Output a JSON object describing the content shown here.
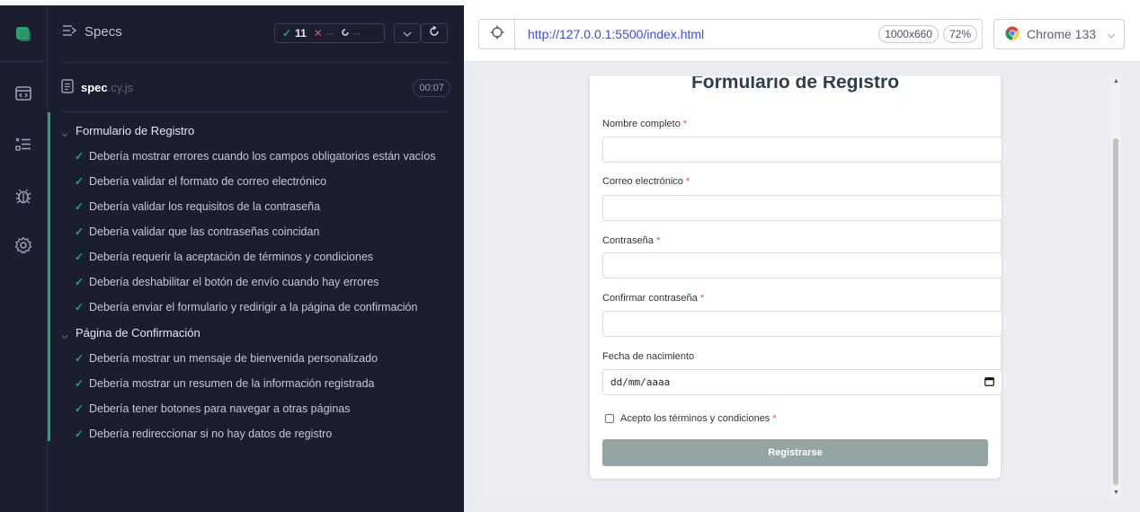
{
  "specs_panel": {
    "title": "Specs",
    "stats": {
      "passed": "11",
      "failed": "--",
      "pending": "--"
    },
    "spec_file": {
      "name": "spec",
      "ext": ".cy.js",
      "duration": "00:07"
    },
    "suites": [
      {
        "title": "Formulario de Registro",
        "tests": [
          "Debería mostrar errores cuando los campos obligatorios están vacíos",
          "Debería validar el formato de correo electrónico",
          "Debería validar los requisitos de la contraseña",
          "Debería validar que las contraseñas coincidan",
          "Debería requerir la aceptación de términos y condiciones",
          "Debería deshabilitar el botón de envío cuando hay errores",
          "Debería enviar el formulario y redirigir a la página de confirmación"
        ]
      },
      {
        "title": "Página de Confirmación",
        "tests": [
          "Debería mostrar un mensaje de bienvenida personalizado",
          "Debería mostrar un resumen de la información registrada",
          "Debería tener botones para navegar a otras páginas",
          "Debería redireccionar si no hay datos de registro"
        ]
      }
    ]
  },
  "aut_header": {
    "url": "http://127.0.0.1:5500/index.html",
    "viewport_size": "1000x660",
    "zoom": "72%",
    "browser": "Chrome 133"
  },
  "form": {
    "title": "Formulario de Registro",
    "fields": [
      {
        "label": "Nombre completo",
        "required": "*"
      },
      {
        "label": "Correo electrónico",
        "required": "*"
      },
      {
        "label": "Contraseña",
        "required": "*"
      },
      {
        "label": "Confirmar contraseña",
        "required": "*"
      },
      {
        "label": "Fecha de nacimiento",
        "required": ""
      }
    ],
    "date_placeholder": "dd/mm/aaaa",
    "terms_label": "Acepto los términos y condiciones",
    "terms_required": "*",
    "submit_label": "Registrarse"
  },
  "colors": {
    "pass": "#1fa971",
    "fail": "#e45770",
    "link": "#3f4cd6",
    "submit_disabled": "#95a5a6",
    "required": "#e74c3c"
  }
}
